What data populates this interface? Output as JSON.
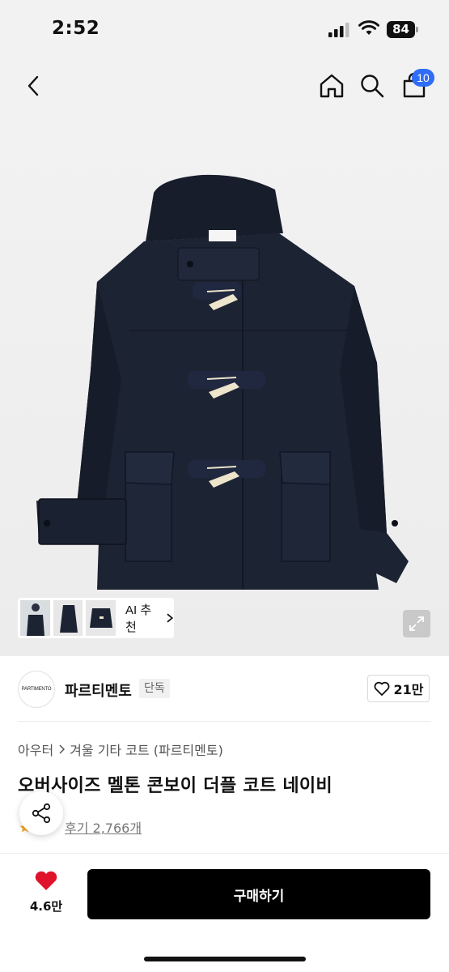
{
  "status": {
    "time": "2:52",
    "battery": "84"
  },
  "nav": {
    "cart_count": "10",
    "icons": [
      "back-icon",
      "home-icon",
      "search-icon",
      "cart-icon"
    ]
  },
  "gallery": {
    "ai_label": "AI 추천"
  },
  "brand": {
    "logo_text": "PARTIMENTO",
    "name": "파르티멘토",
    "exclusive": "단독",
    "likes": "21만"
  },
  "breadcrumb": {
    "category": "아우터",
    "subcategory": "겨울 기타 코트 (파르티멘토)"
  },
  "product": {
    "title": "오버사이즈 멜톤 콘보이 더플 코트 네이비",
    "reviews": "후기 2,766개"
  },
  "bottom": {
    "favorites": "4.6만",
    "buy_label": "구매하기"
  },
  "colors": {
    "accent_blue": "#2f6df6",
    "coat_navy": "#1c2333",
    "heart_red": "#e0112b",
    "buy_bg": "#000000"
  }
}
